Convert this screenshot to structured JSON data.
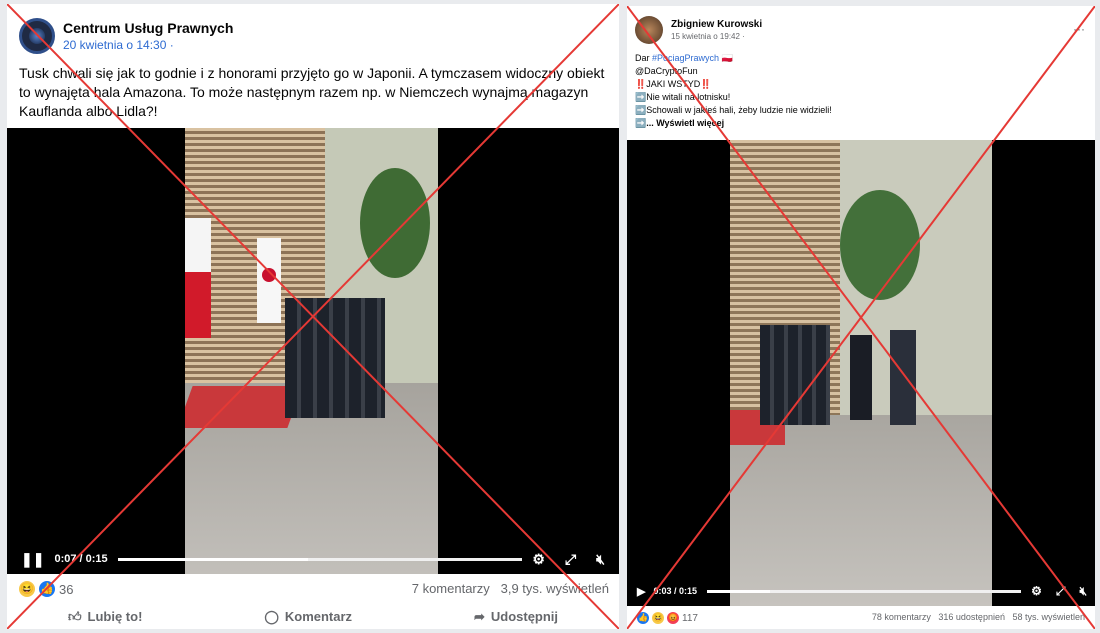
{
  "left_post": {
    "page_name": "Centrum Usług Prawnych",
    "timestamp": "20 kwietnia o 14:30 ·",
    "body_text": "Tusk chwali się jak to godnie i z honorami przyjęto go w Japonii. A tymczasem widoczny obiekt to wynajęta hala Amazona. To może następnym razem np. w Niemczech wynajmą magazyn Kauflanda albo Lidla?!",
    "video": {
      "time": "0:07 / 0:15",
      "progress": 0.47
    },
    "reactions_count": "36",
    "comments": "7 komentarzy",
    "views": "3,9 tys. wyświetleń",
    "actions": {
      "like": "Lubię to!",
      "comment": "Komentarz",
      "share": "Udostępnij"
    }
  },
  "right_post": {
    "author": "Zbigniew Kurowski",
    "timestamp": "15 kwietnia o 19:42 ·",
    "more": "···",
    "lines": {
      "l1_prefix": "Dar ",
      "l1_tag": "#PociagPrawych",
      "l2": "@DaCryptoFun",
      "l3": "‼️JAKI WSTYD‼️",
      "l4": "Nie witali na lotnisku!",
      "l5": "Schowali w jakieś hali, żeby ludzie nie widzieli!",
      "l6": "... Wyświetl więcej"
    },
    "video": {
      "time": "0:03 / 0:15",
      "progress": 0.2
    },
    "reactions_count": "117",
    "stats": "78 komentarzy   316 udostępnień   58 tys. wyświetleń"
  },
  "colors": {
    "cross": "#e53935",
    "link": "#2e6bd1",
    "muted": "#65676b"
  }
}
